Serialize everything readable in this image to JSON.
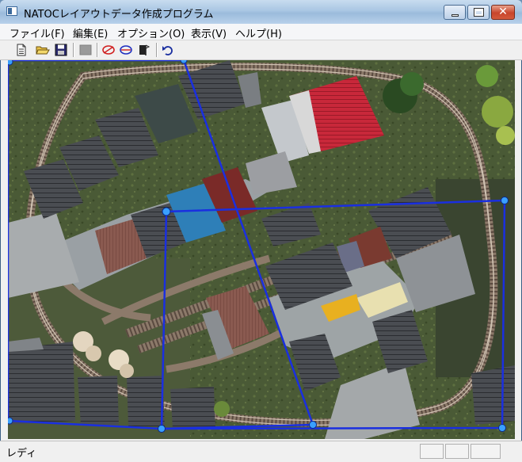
{
  "window": {
    "title": "NATOCレイアウトデータ作成プログラム"
  },
  "menu": {
    "items": [
      {
        "label": "ファイル(F)"
      },
      {
        "label": "編集(E)"
      },
      {
        "label": "オプション(O)"
      },
      {
        "label": "表示(V)"
      },
      {
        "label": "ヘルプ(H)"
      }
    ]
  },
  "toolbar": {
    "buttons": [
      "new-file",
      "open-folder",
      "save",
      "stop",
      "ellipse-red",
      "ellipse-blue",
      "flag",
      "undo"
    ]
  },
  "status": {
    "text": "レディ"
  },
  "colors": {
    "polygon": "#1a2fe0",
    "track": "#a08a78",
    "roof_red": "#c8283a",
    "roof_blue": "#2e7fb8"
  }
}
